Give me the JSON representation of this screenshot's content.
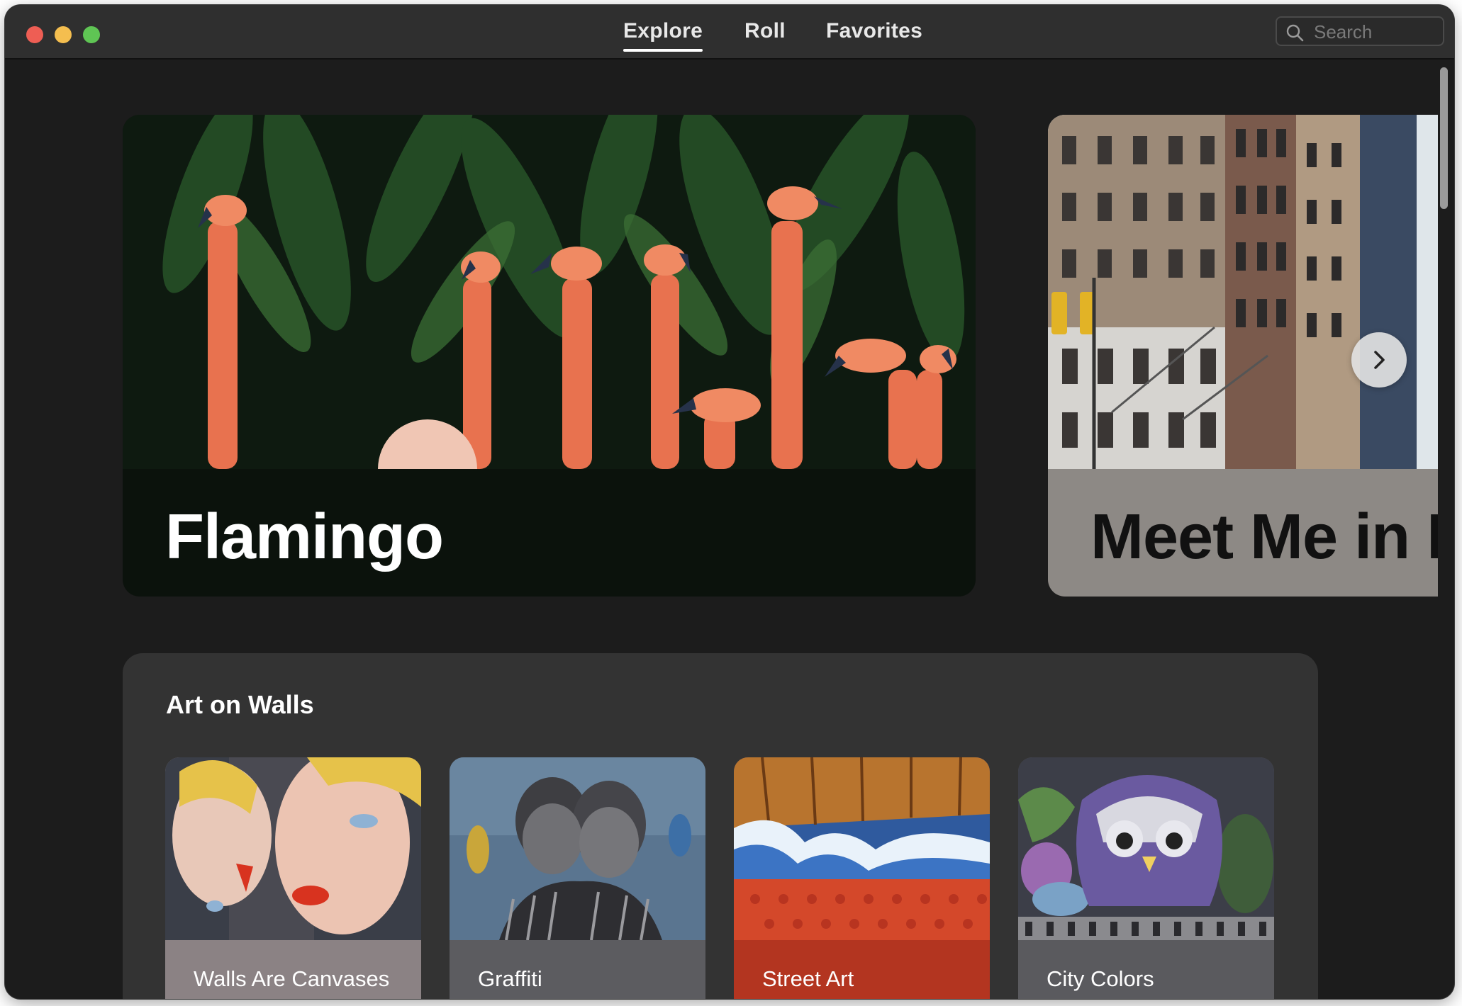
{
  "tabs": [
    {
      "label": "Explore",
      "active": true
    },
    {
      "label": "Roll",
      "active": false
    },
    {
      "label": "Favorites",
      "active": false
    }
  ],
  "search": {
    "placeholder": "Search"
  },
  "featured": [
    {
      "title": "Flamingo"
    },
    {
      "title": "Meet Me in N"
    }
  ],
  "section": {
    "title": "Art on Walls",
    "cards": [
      {
        "label": "Walls Are Canvases"
      },
      {
        "label": "Graffiti"
      },
      {
        "label": "Street Art"
      },
      {
        "label": "City Colors"
      }
    ]
  },
  "colors": {
    "card_1": "#8b8284",
    "card_2": "#5c5c60",
    "card_3": "#b33520",
    "card_4": "#5a5a5e"
  },
  "icons": [
    "search-icon",
    "chevron-right-icon"
  ]
}
